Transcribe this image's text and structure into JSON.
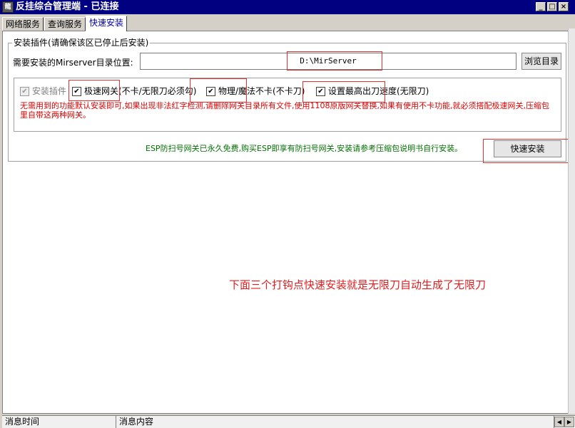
{
  "window": {
    "title": "反挂综合管理端 - 已连接",
    "icon_glyph": "龍",
    "minimize_glyph": "_",
    "maximize_glyph": "□",
    "close_glyph": "×"
  },
  "tabs": [
    {
      "label": "网络服务"
    },
    {
      "label": "查询服务"
    },
    {
      "label": "快速安装"
    }
  ],
  "install": {
    "group_title": "安装插件(请确保该区已停止后安装)",
    "dir_label": "需要安装的Mirserver目录位置:",
    "dir_value": "D:\\MirServer",
    "browse_label": "浏览目录",
    "plugin_checkbox_label": "安装插件",
    "options": [
      {
        "label": "极速网关(不卡/无限刀必须勾)",
        "checked": true
      },
      {
        "label": "物理/魔法不卡(不卡刀)",
        "checked": true
      },
      {
        "label": "设置最高出刀速度(无限刀)",
        "checked": true
      }
    ],
    "warning": "无需用到的功能默认安装即可,如果出现非法红字检测,请删除网关目录所有文件,使用1108原版网关替换,如果有使用不卡功能,就必须搭配极速网关,压缩包里自带这两种网关。",
    "esp_note": "ESP防扫号网关已永久免费,购买ESP即享有防扫号网关,安装请参考压缩包说明书自行安装。",
    "quick_install_label": "快速安装"
  },
  "annotation_text": "下面三个打钩点快速安装就是无限刀自动生成了无限刀",
  "checkmark": "✔",
  "status_columns": [
    "消息时间",
    "消息内容"
  ],
  "scroll_left_glyph": "◀",
  "scroll_right_glyph": "▶",
  "colors": {
    "title_bar": "#000080",
    "warning": "#e00000",
    "esp_note": "#007000",
    "annotation": "#e53030"
  }
}
